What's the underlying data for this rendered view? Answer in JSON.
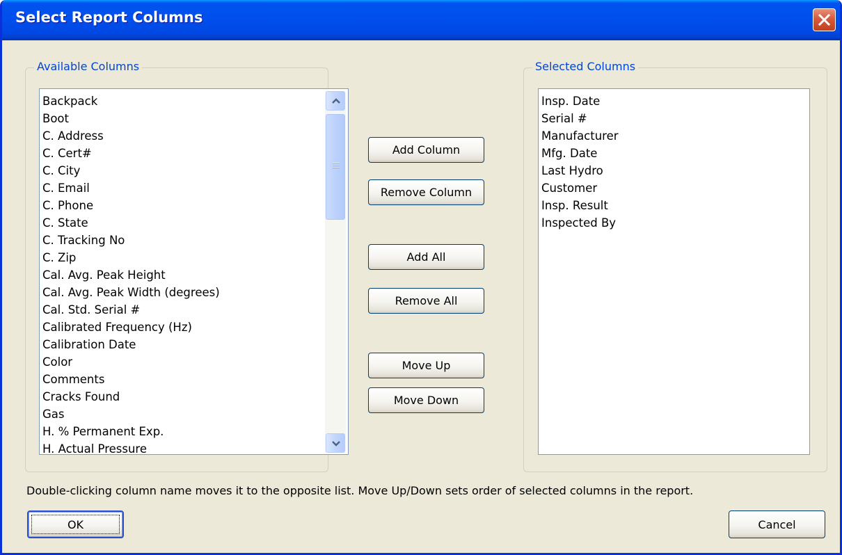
{
  "window": {
    "title": "Select Report Columns",
    "close_icon": "close-icon"
  },
  "available_columns": {
    "label": "Available Columns",
    "items": [
      "Backpack",
      "Boot",
      "C. Address",
      "C. Cert#",
      "C. City",
      "C. Email",
      "C. Phone",
      "C. State",
      "C. Tracking No",
      "C. Zip",
      "Cal. Avg. Peak Height",
      "Cal. Avg. Peak Width (degrees)",
      "Cal. Std. Serial #",
      "Calibrated Frequency (Hz)",
      "Calibration Date",
      "Color",
      "Comments",
      "Cracks Found",
      "Gas",
      "H. % Permanent Exp.",
      "H. Actual Pressure"
    ]
  },
  "selected_columns": {
    "label": "Selected Columns",
    "items": [
      "Insp. Date",
      "Serial #",
      "Manufacturer",
      "Mfg. Date",
      "Last Hydro",
      "Customer",
      "Insp. Result",
      "Inspected By"
    ]
  },
  "buttons": {
    "add_column": "Add Column",
    "remove_column": "Remove Column",
    "add_all": "Add All",
    "remove_all": "Remove All",
    "move_up": "Move Up",
    "move_down": "Move Down",
    "ok": "OK",
    "cancel": "Cancel"
  },
  "hint": "Double-clicking column name moves it to the opposite list. Move Up/Down sets order of selected columns in the report.",
  "colors": {
    "title_bar": "#0053ee",
    "dialog_background": "#ece9d8",
    "group_label": "#0046d5",
    "close_button": "#d8593b"
  }
}
